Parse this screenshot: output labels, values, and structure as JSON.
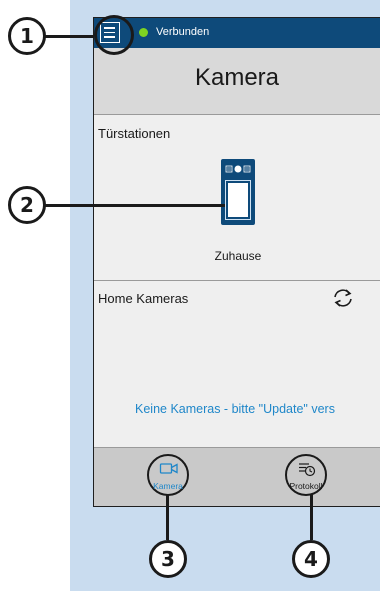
{
  "status": {
    "label": "Verbunden",
    "color": "#7ed321"
  },
  "header": {
    "title": "Kamera"
  },
  "doorstations": {
    "section_label": "Türstationen",
    "items": [
      {
        "label": "Zuhause"
      }
    ]
  },
  "home_cameras": {
    "section_label": "Home Kameras",
    "empty_message": "Keine Kameras - bitte \"Update\" vers"
  },
  "tabs": [
    {
      "label": "Kamera",
      "icon": "video-camera-icon",
      "active": true
    },
    {
      "label": "Protokoll",
      "icon": "log-clock-icon",
      "active": false
    }
  ],
  "callouts": [
    "1",
    "2",
    "3",
    "4"
  ],
  "colors": {
    "topbar": "#0e4a7a",
    "accent": "#1f87c9",
    "background": "#c9dcef"
  }
}
